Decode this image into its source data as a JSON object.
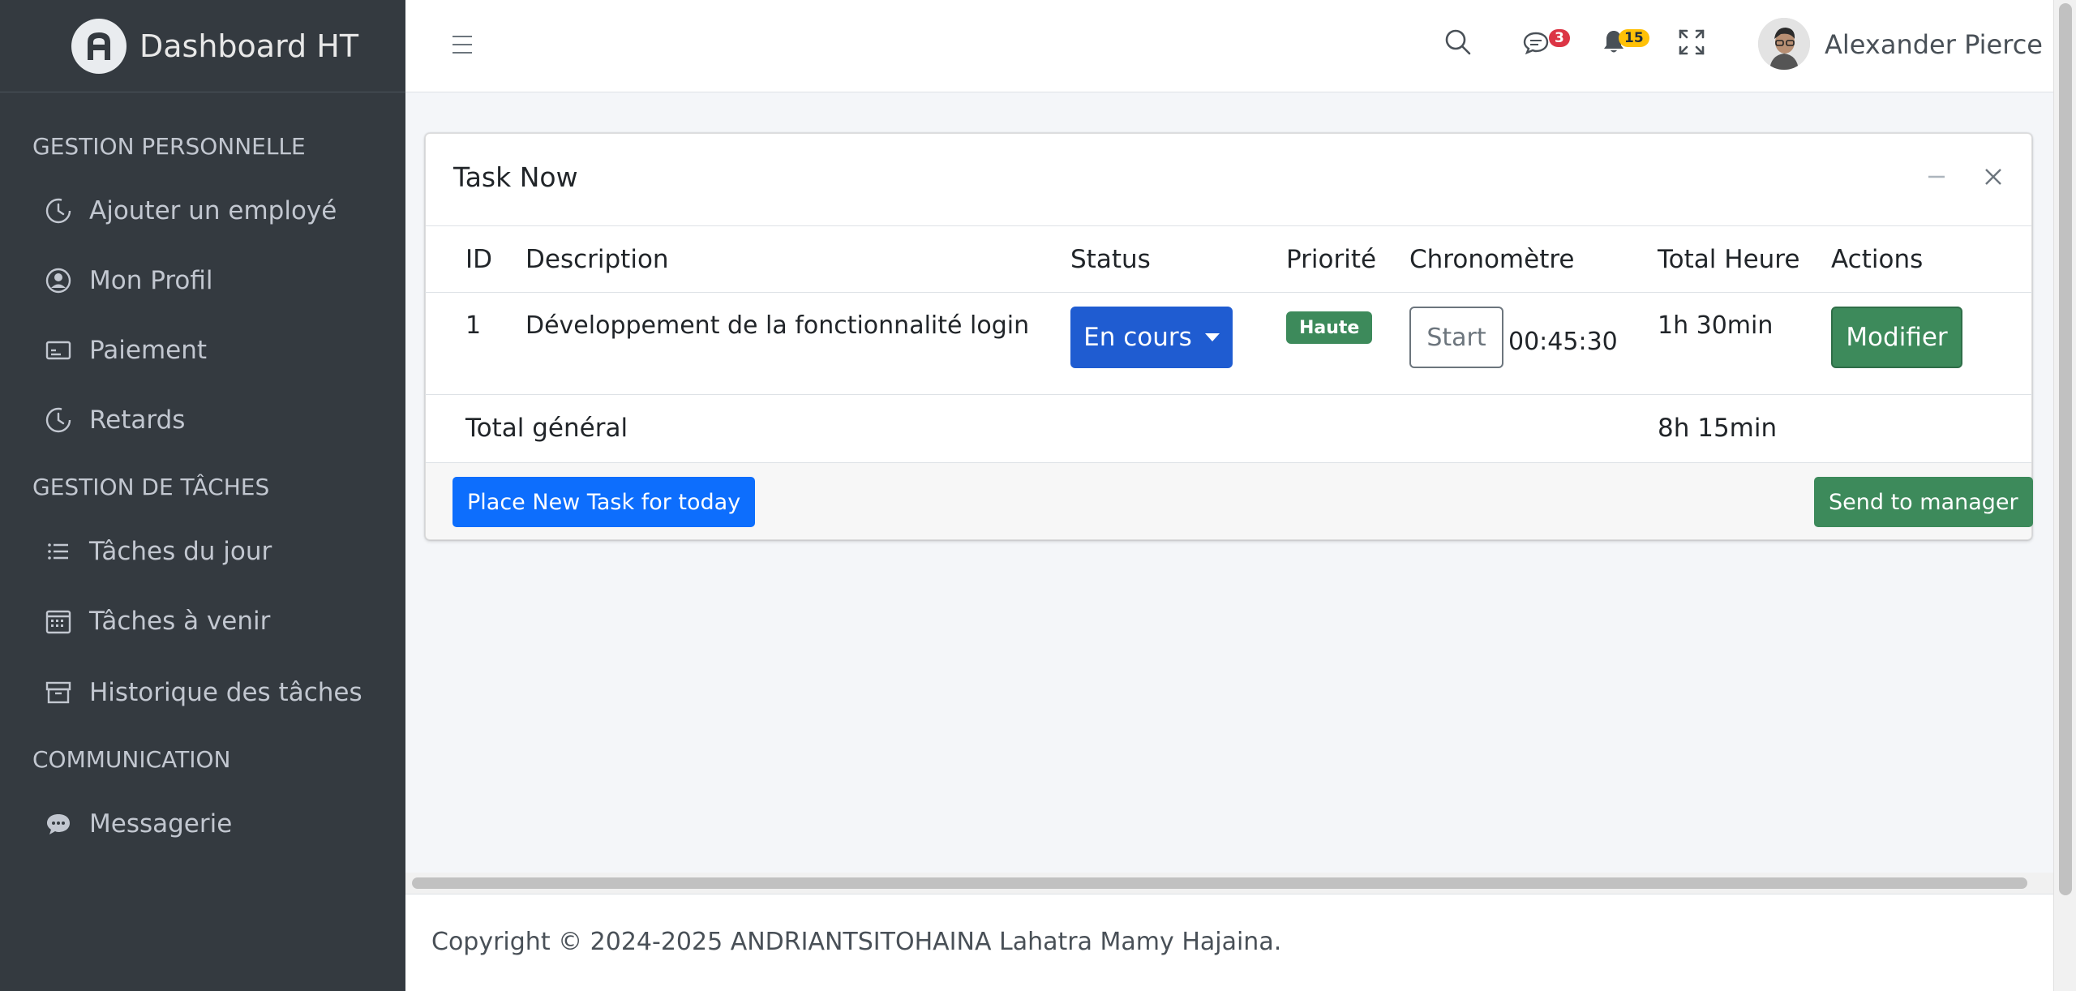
{
  "brand": {
    "title": "Dashboard HT"
  },
  "sidebar": {
    "sections": [
      {
        "header": "GESTION PERSONNELLE"
      },
      {
        "header": "GESTION DE TÂCHES"
      },
      {
        "header": "COMMUNICATION"
      }
    ],
    "items": [
      {
        "label": "Ajouter un employé",
        "icon": "clock-icon"
      },
      {
        "label": "Mon Profil",
        "icon": "user-circle-icon"
      },
      {
        "label": "Paiement",
        "icon": "credit-card-icon"
      },
      {
        "label": "Retards",
        "icon": "clock-icon"
      },
      {
        "label": "Tâches du jour",
        "icon": "list-icon"
      },
      {
        "label": "Tâches à venir",
        "icon": "calendar-icon"
      },
      {
        "label": "Historique des tâches",
        "icon": "archive-icon"
      },
      {
        "label": "Messagerie",
        "icon": "chat-bubble-icon"
      }
    ]
  },
  "header": {
    "messages_count": "3",
    "notifications_count": "15",
    "user_name": "Alexander Pierce"
  },
  "card": {
    "title": "Task Now",
    "columns": [
      "ID",
      "Description",
      "Status",
      "Priorité",
      "Chronomètre",
      "Total Heure",
      "Actions"
    ],
    "rows": [
      {
        "id": "1",
        "description": "Développement de la fonctionnalité login",
        "status": "En cours",
        "priority": "Haute",
        "start_label": "Start",
        "timer": "00:45:30",
        "total": "1h 30min",
        "action": "Modifier"
      }
    ],
    "total_label": "Total général",
    "total_value": "8h 15min",
    "new_task_button": "Place New Task for today",
    "send_button": "Send to manager"
  },
  "footer": {
    "text": "Copyright © 2024-2025  ANDRIANTSITOHAINA Lahatra Mamy Hajaina."
  },
  "colors": {
    "sidebar_bg": "#343a40",
    "primary": "#0d6efd",
    "success": "#3d8a5b",
    "danger": "#dc3545",
    "warning": "#ffc107"
  }
}
